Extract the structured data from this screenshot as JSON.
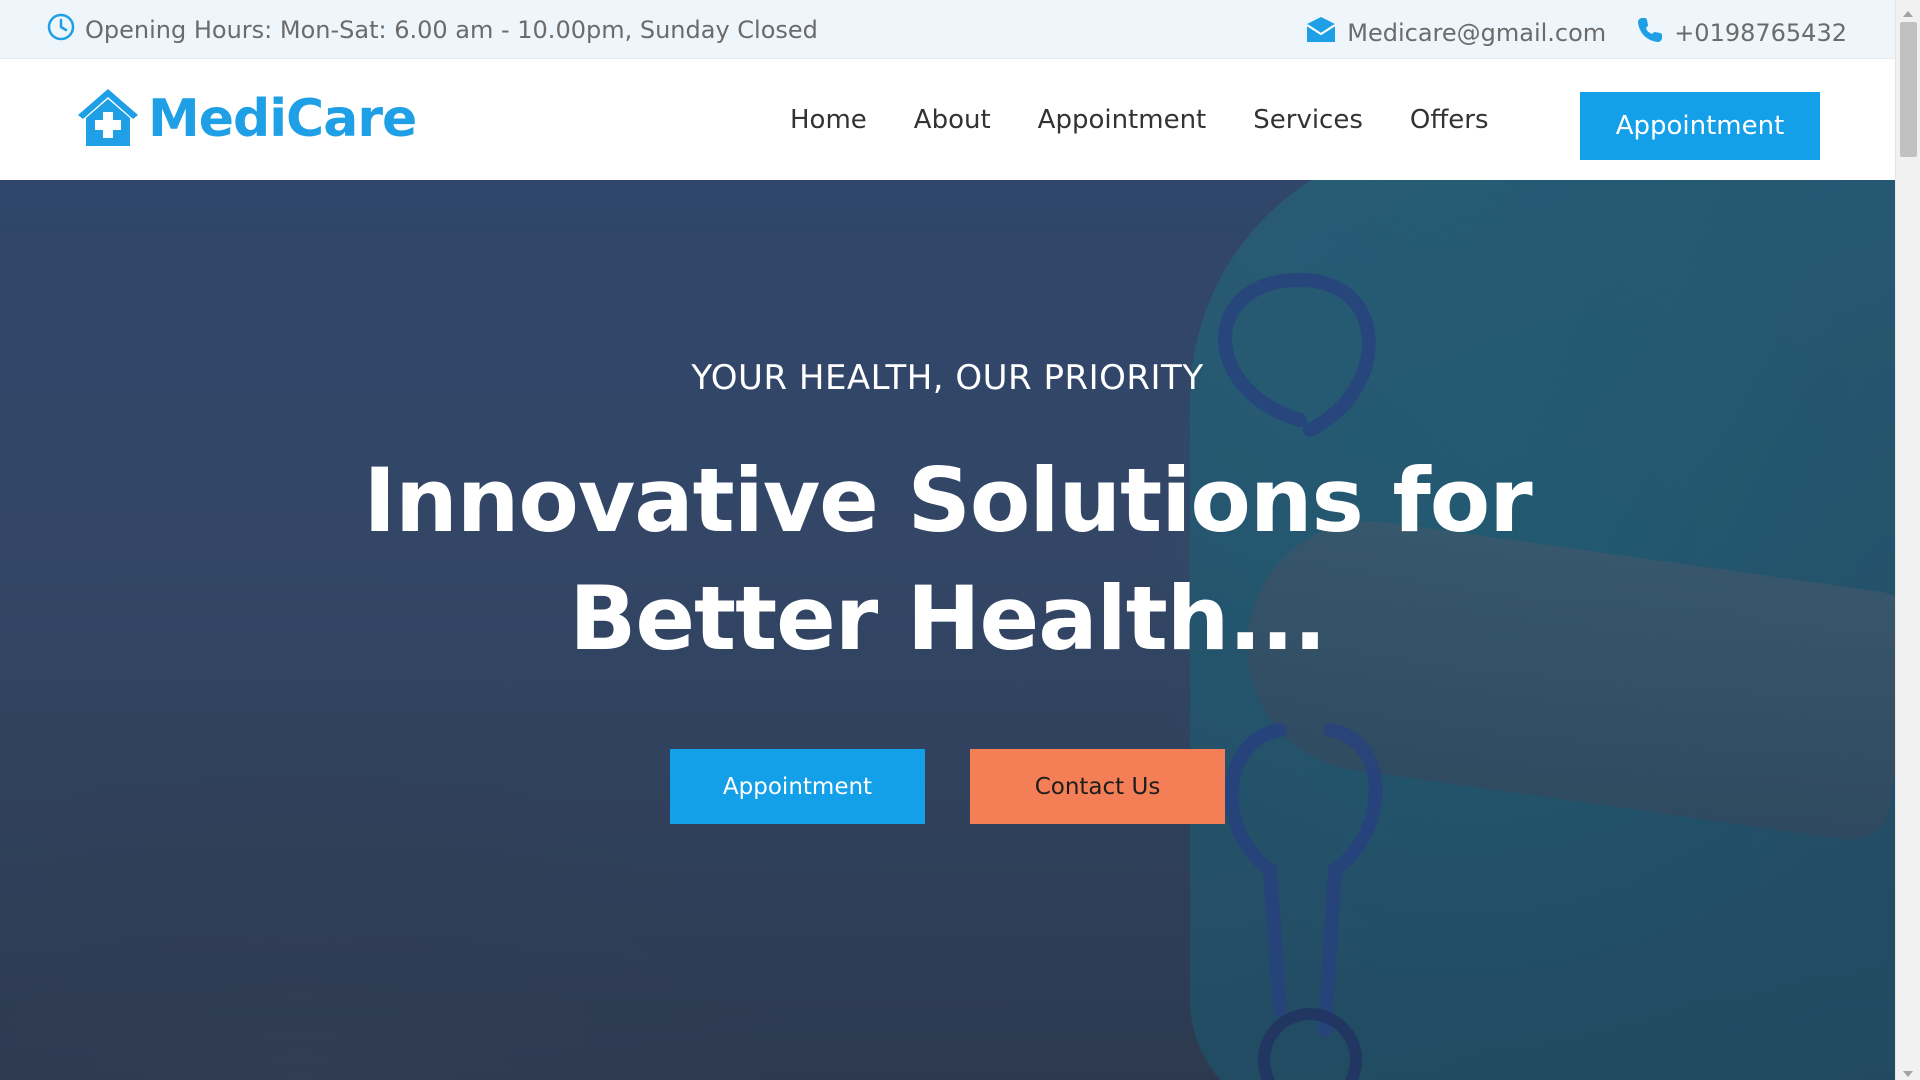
{
  "topbar": {
    "hours_icon": "clock-icon",
    "hours_text": "Opening Hours: Mon-Sat: 6.00 am - 10.00pm, Sunday Closed",
    "email_icon": "envelope-icon",
    "email": "Medicare@gmail.com",
    "phone_icon": "phone-icon",
    "phone": "+0198765432"
  },
  "header": {
    "logo_icon": "house-medical-icon",
    "logo_text": "MediCare",
    "nav": {
      "home": "Home",
      "about": "About",
      "appointment": "Appointment",
      "services": "Services",
      "offers": "Offers"
    },
    "cta_label": "Appointment"
  },
  "hero": {
    "eyebrow": "YOUR HEALTH, OUR PRIORITY",
    "headline_line1": "Innovative Solutions for",
    "headline_line2": "Better Health...",
    "primary_button": "Appointment",
    "secondary_button": "Contact Us"
  },
  "colors": {
    "brand_blue": "#13a0e8",
    "accent_orange": "#f47f57",
    "topbar_bg": "#eef6fc"
  }
}
